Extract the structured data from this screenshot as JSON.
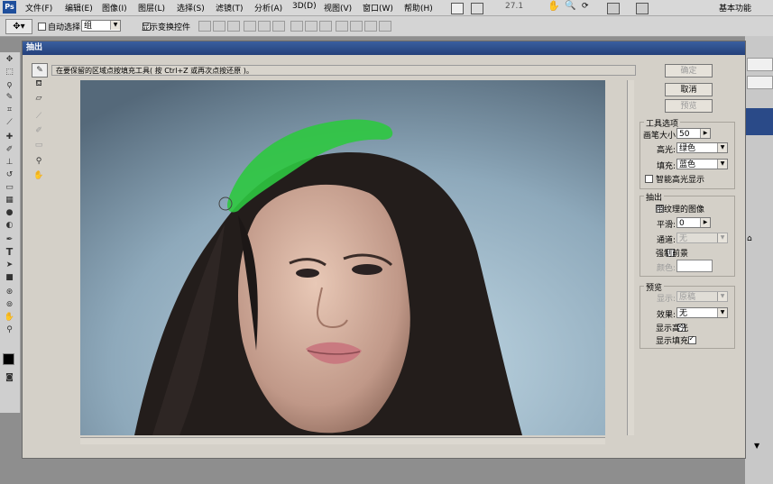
{
  "menubar": {
    "app_logo": "Ps",
    "items": [
      "文件(F)",
      "编辑(E)",
      "图像(I)",
      "图层(L)",
      "选择(S)",
      "滤镜(T)",
      "分析(A)",
      "3D(D)",
      "视图(V)",
      "窗口(W)",
      "帮助(H)"
    ],
    "zoom": "27.1",
    "workspace": "基本功能"
  },
  "options": {
    "auto_select_label": "自动选择:",
    "auto_select_value": "组",
    "show_transform_label": "显示变换控件"
  },
  "dialog": {
    "title": "抽出",
    "hint": "在要保留的区域点按填充工具( 按 Ctrl+Z 或再次点按还原 )。",
    "buttons": {
      "ok": "确定",
      "cancel": "取消",
      "preview": "预览"
    },
    "tool_options": {
      "title": "工具选项",
      "brush_size_label": "画笔大小:",
      "brush_size": "50",
      "highlight_label": "高光:",
      "highlight_value": "绿色",
      "fill_label": "填充:",
      "fill_value": "蓝色",
      "smart_highlight_label": "智能高光显示"
    },
    "extraction": {
      "title": "抽出",
      "textured_label": "带纹理的图像",
      "smooth_label": "平滑:",
      "smooth_value": "0",
      "channel_label": "通道:",
      "channel_value": "无",
      "force_fg_label": "强制前景",
      "color_label": "颜色:"
    },
    "preview": {
      "title": "预览",
      "show_label": "显示:",
      "show_value": "原稿",
      "effect_label": "效果:",
      "effect_value": "无",
      "show_highlight_label": "显示高光",
      "show_fill_label": "显示填充"
    },
    "checks": {
      "smart_highlight": false,
      "textured": false,
      "force_fg": false,
      "show_highlight": true,
      "show_fill": true
    }
  },
  "colors": {
    "highlight": "#2ec840",
    "titlebar": "#2b4b8a",
    "dialog_bg": "#d4d0c8"
  }
}
